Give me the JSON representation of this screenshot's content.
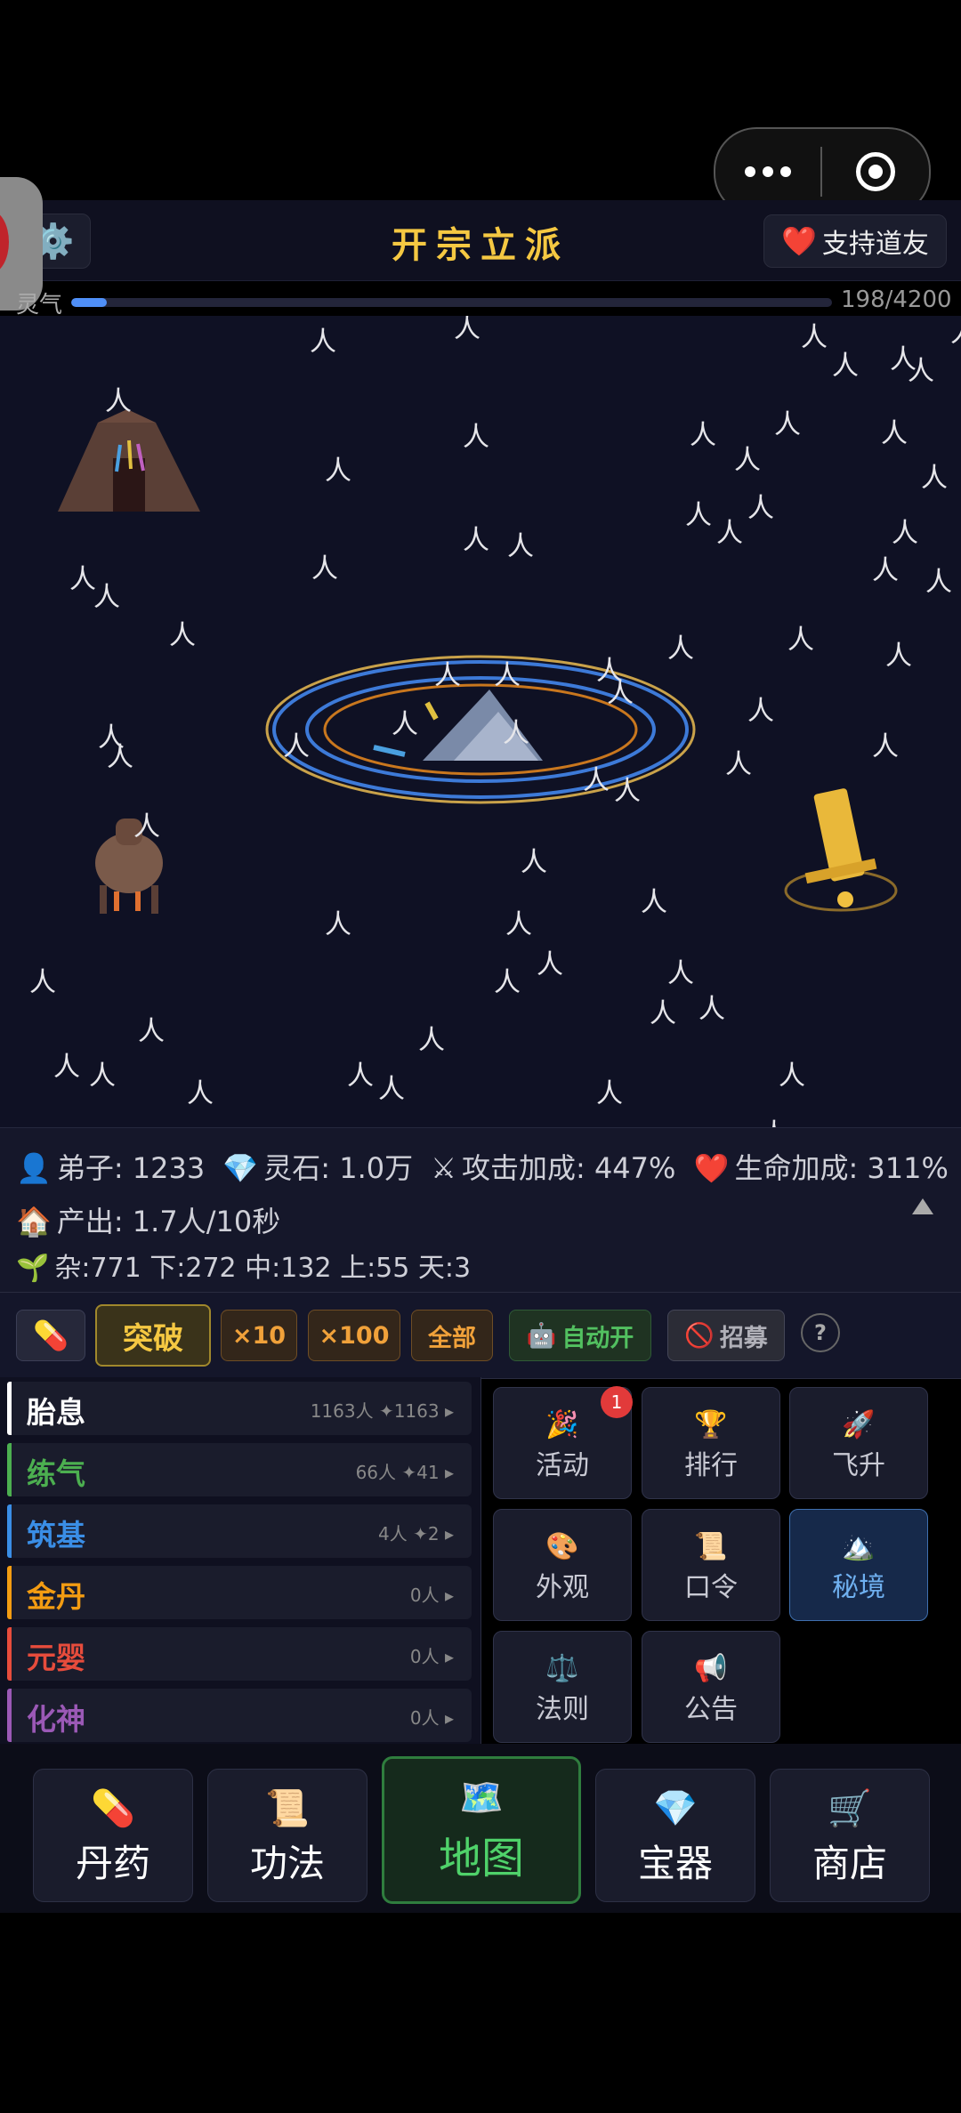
{
  "header": {
    "title": "开宗立派",
    "support_label": "支持道友"
  },
  "qi": {
    "label": "灵气",
    "value": "198/4200",
    "progress": 0.047
  },
  "stats": {
    "disciples": "弟子: 1233",
    "spirit_stones": "灵石: 1.0万",
    "attack_bonus": "攻击加成: 447%",
    "life_bonus": "生命加成: 311%",
    "output": "产出: 1.7人/10秒",
    "tiers": "杂:771 下:272 中:132 上:55 天:3"
  },
  "actions": {
    "breakthrough": "突破",
    "x10": "×10",
    "x100": "×100",
    "all": "全部",
    "auto": "自动开",
    "recruit": "招募",
    "help": "?"
  },
  "realms": [
    {
      "name": "胎息",
      "info": "1163人 ✦1163 ▸",
      "color": "#ffffff"
    },
    {
      "name": "练气",
      "info": "66人 ✦41 ▸",
      "color": "#4caf50"
    },
    {
      "name": "筑基",
      "info": "4人 ✦2 ▸",
      "color": "#3a8ee6"
    },
    {
      "name": "金丹",
      "info": "0人 ▸",
      "color": "#f39c12"
    },
    {
      "name": "元婴",
      "info": "0人 ▸",
      "color": "#e74c3c"
    },
    {
      "name": "化神",
      "info": "0人 ▸",
      "color": "#9b59b6"
    }
  ],
  "features": {
    "activity": {
      "label": "活动",
      "icon": "🎉",
      "badge": "1"
    },
    "ranking": {
      "label": "排行",
      "icon": "🏆"
    },
    "ascend": {
      "label": "飞升",
      "icon": "🚀"
    },
    "appearance": {
      "label": "外观",
      "icon": "🎨"
    },
    "code": {
      "label": "口令",
      "icon": "📜"
    },
    "secret_realm": {
      "label": "秘境",
      "icon": "🏔️"
    },
    "law": {
      "label": "法则",
      "icon": "⚖️"
    },
    "notice": {
      "label": "公告",
      "icon": "📢"
    }
  },
  "nav": {
    "pills": {
      "label": "丹药",
      "icon": "💊"
    },
    "skills": {
      "label": "功法",
      "icon": "📜"
    },
    "map": {
      "label": "地图",
      "icon": "🗺️"
    },
    "treasure": {
      "label": "宝器",
      "icon": "💎"
    },
    "shop": {
      "label": "商店",
      "icon": "🛒"
    }
  },
  "icons": {
    "gear": "gear-icon",
    "heart": "heart-icon",
    "person": "人"
  },
  "colors": {
    "title": "#f5c842",
    "accent_blue": "#4f8ff7",
    "active_green": "#4fd26a"
  }
}
